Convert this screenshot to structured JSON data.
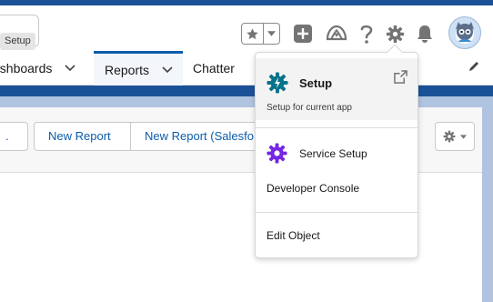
{
  "header": {
    "tooltip": "Setup",
    "icons": [
      "favorites-star-icon",
      "favorites-dropdown-icon",
      "global-actions-icon",
      "trailhead-guidance-icon",
      "help-icon",
      "setup-gear-icon",
      "notifications-bell-icon",
      "user-avatar"
    ]
  },
  "nav": {
    "items": [
      {
        "label": "ashboards"
      },
      {
        "label": "Reports"
      },
      {
        "label": "Chatter"
      }
    ]
  },
  "toolbar": {
    "first_button": ".",
    "new_report": "New Report",
    "new_report_salesforce": "New Report (Salesfo"
  },
  "setup_menu": {
    "setup_title": "Setup",
    "setup_subtitle": "Setup for current app",
    "service_setup": "Service Setup",
    "developer_console": "Developer Console",
    "edit_object": "Edit Object"
  },
  "colors": {
    "brand_blue": "#1b5297",
    "link_blue": "#0b5cab",
    "setup_gear_blue": "#06738b",
    "service_gear_purple": "#7526e3"
  }
}
